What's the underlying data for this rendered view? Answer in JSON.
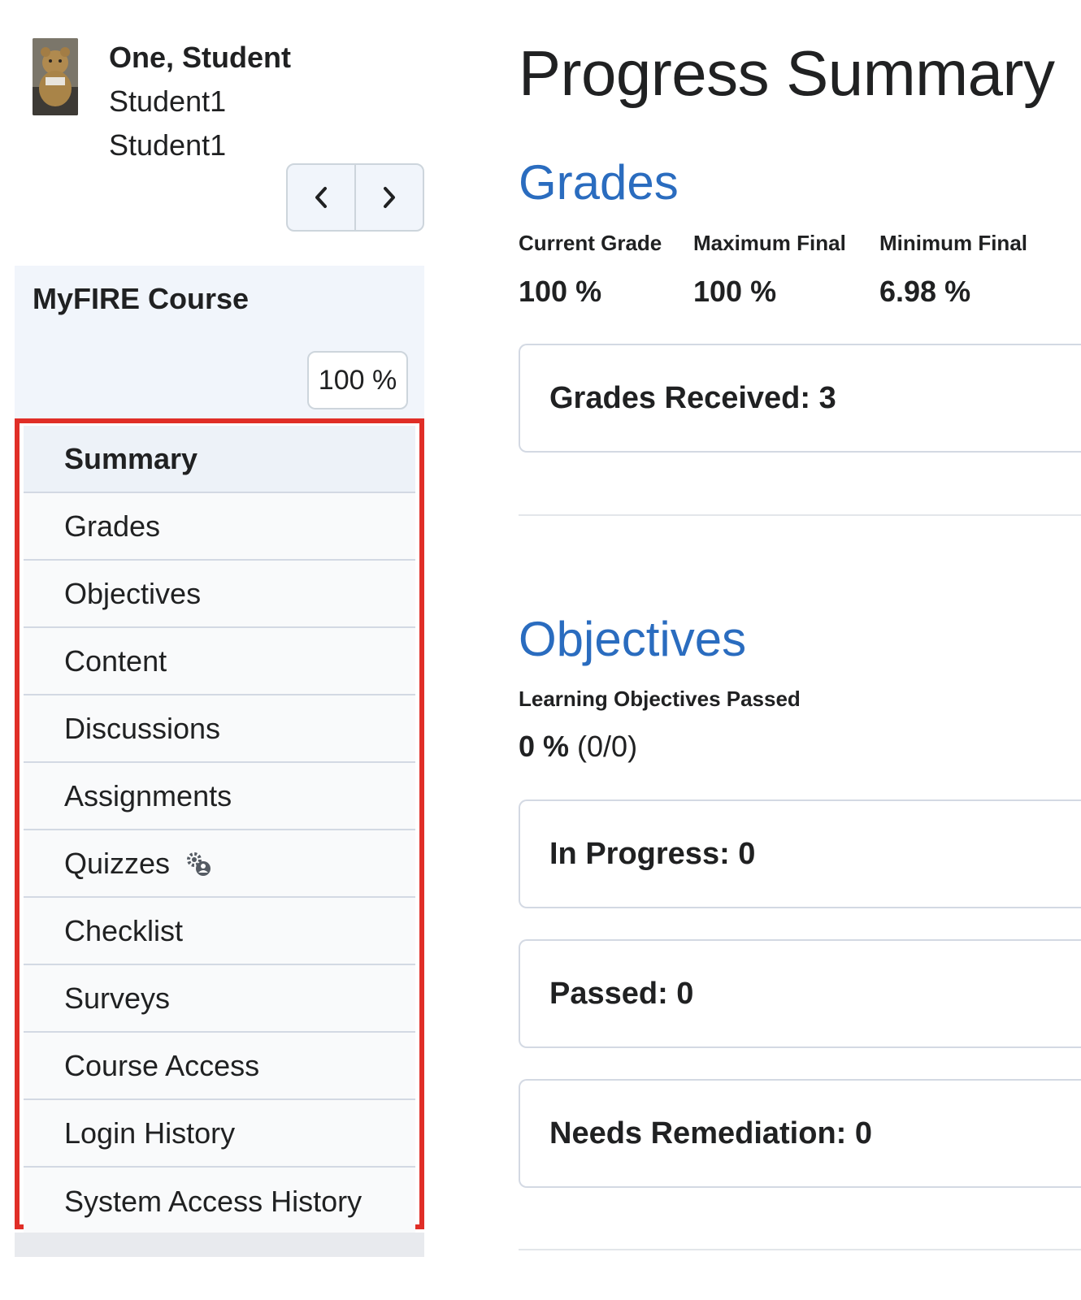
{
  "student": {
    "name": "One, Student",
    "username": "Student1",
    "org_id": "Student1"
  },
  "course": {
    "title": "MyFIRE Course",
    "percent": "100 %"
  },
  "nav": {
    "items": [
      {
        "label": "Summary",
        "active": true
      },
      {
        "label": "Grades"
      },
      {
        "label": "Objectives"
      },
      {
        "label": "Content"
      },
      {
        "label": "Discussions"
      },
      {
        "label": "Assignments"
      },
      {
        "label": "Quizzes",
        "icon": "gear-user-icon"
      },
      {
        "label": "Checklist"
      },
      {
        "label": "Surveys"
      },
      {
        "label": "Course Access"
      },
      {
        "label": "Login History"
      },
      {
        "label": "System Access History"
      }
    ]
  },
  "page": {
    "title": "Progress Summary"
  },
  "grades": {
    "title": "Grades",
    "stats": [
      {
        "label": "Current Grade",
        "value": "100 %"
      },
      {
        "label": "Maximum Final",
        "value": "100 %"
      },
      {
        "label": "Minimum Final",
        "value": "6.98 %"
      }
    ],
    "received": "Grades Received: 3"
  },
  "objectives": {
    "title": "Objectives",
    "label": "Learning Objectives Passed",
    "value": "0 %",
    "fraction": "(0/0)",
    "cards": [
      "In Progress: 0",
      "Passed: 0",
      "Needs Remediation: 0"
    ]
  },
  "colors": {
    "accent": "#2a6cbf",
    "highlight_border": "#e02e27",
    "nav_active_bg": "#edf2f8"
  }
}
